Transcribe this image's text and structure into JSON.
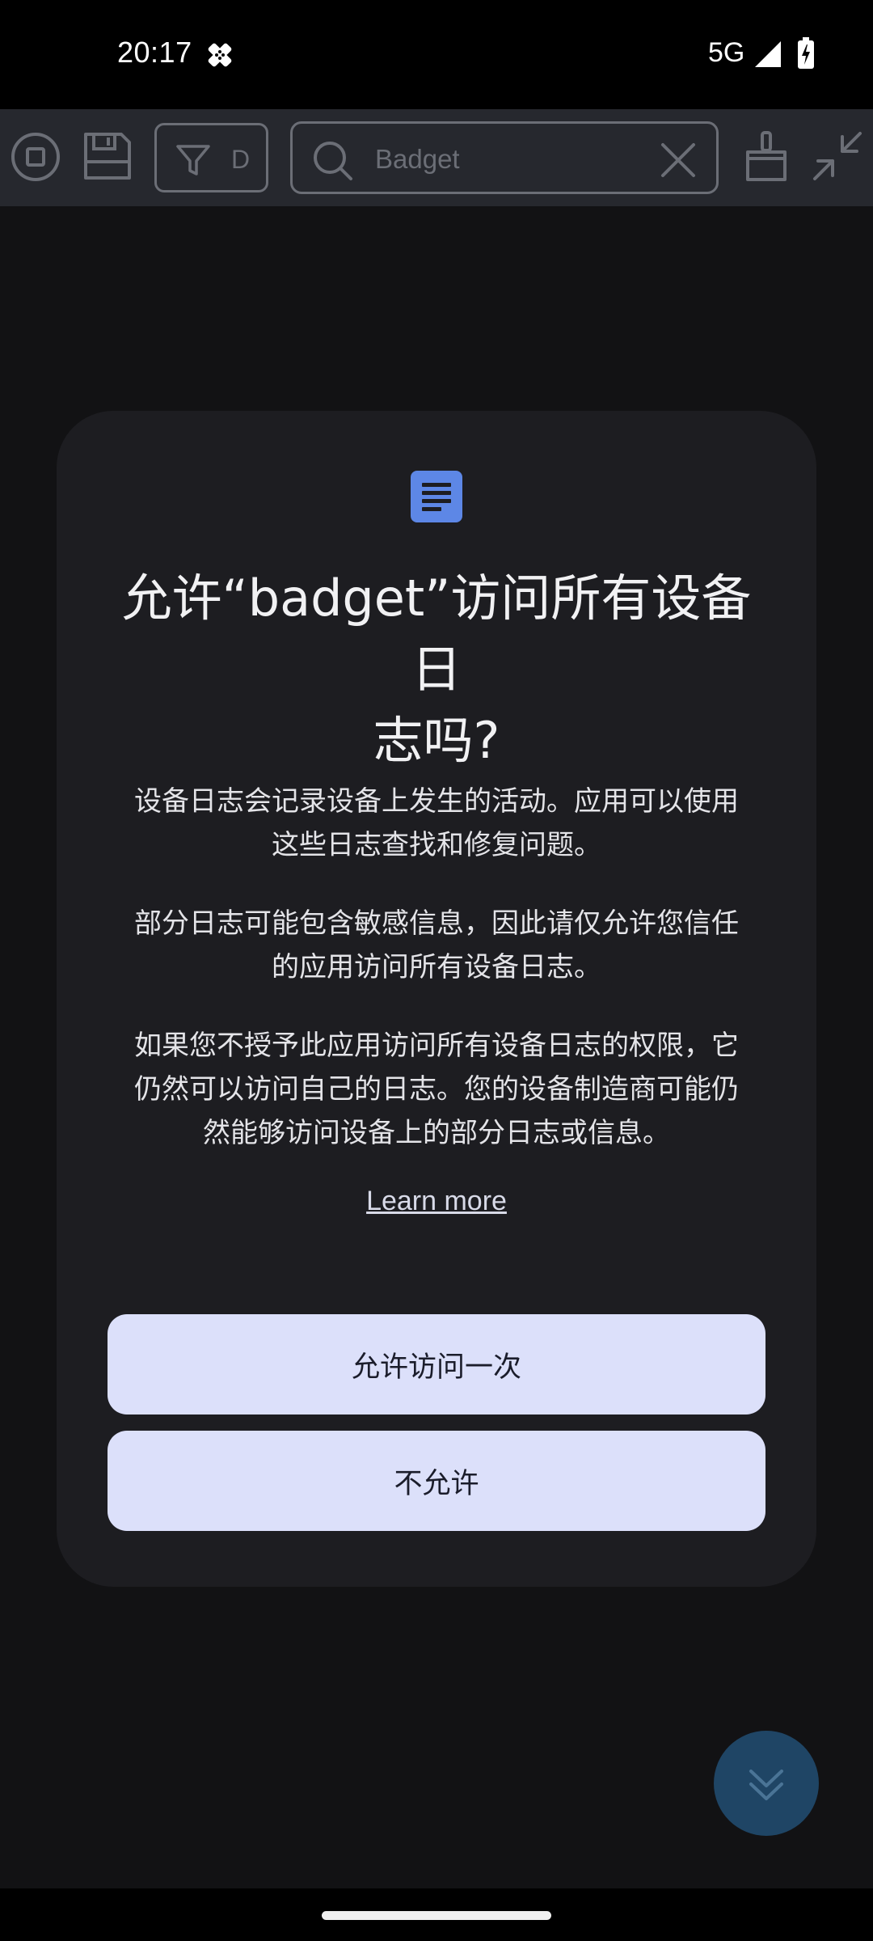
{
  "status_bar": {
    "time": "20:17",
    "network": "5G",
    "notification_icon": "cross-badge-icon",
    "signal_icon": "signal-icon",
    "battery_icon": "battery-charging-icon"
  },
  "toolbar": {
    "stop_icon": "stop-icon",
    "save_icon": "save-icon",
    "filter_icon": "filter-icon",
    "filter_label": "D",
    "search_placeholder": "Badget",
    "clear_icon": "close-icon",
    "clear_logs_icon": "broom-icon",
    "collapse_icon": "collapse-icon"
  },
  "dialog": {
    "icon": "document-icon",
    "icon_color": "#5d87e6",
    "title_line1": "允许“badget”访问所有设备日",
    "title_line2": "志吗?",
    "para1_line1": "设备日志会记录设备上发生的活动。应用可以使用",
    "para1_line2": "这些日志查找和修复问题。",
    "para2_line1": "部分日志可能包含敏感信息，因此请仅允许您信任",
    "para2_line2": "的应用访问所有设备日志。",
    "para3_line1": "如果您不授予此应用访问所有设备日志的权限，它",
    "para3_line2": "仍然可以访问自己的日志。您的设备制造商可能仍",
    "para3_line3": "然能够访问设备上的部分日志或信息。",
    "learn_more": "Learn more",
    "allow_once_button": "允许访问一次",
    "deny_button": "不允许",
    "button_color": "#dce0fa"
  },
  "fab": {
    "icon": "double-chevron-down-icon",
    "color": "#1f4565"
  }
}
